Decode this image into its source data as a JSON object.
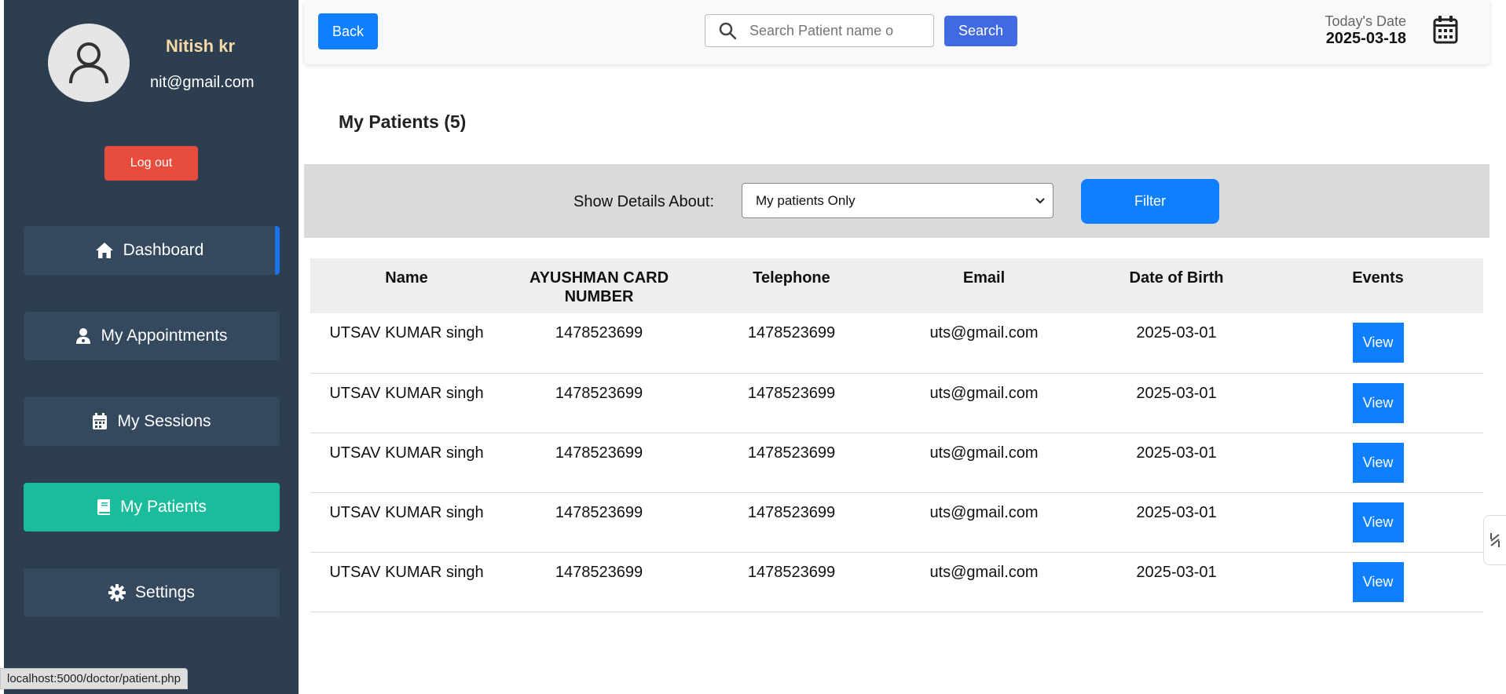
{
  "user": {
    "name": "Nitish kr",
    "email": "nit@gmail.com",
    "logout_label": "Log out"
  },
  "nav": [
    {
      "label": "Dashboard",
      "icon": "home-icon"
    },
    {
      "label": "My Appointments",
      "icon": "doctor-icon"
    },
    {
      "label": "My Sessions",
      "icon": "calendar-icon"
    },
    {
      "label": "My Patients",
      "icon": "book-icon"
    },
    {
      "label": "Settings",
      "icon": "gear-icon"
    }
  ],
  "topbar": {
    "back_label": "Back",
    "search_placeholder": "Search Patient name o",
    "search_label": "Search",
    "date_label": "Today's Date",
    "date_value": "2025-03-18"
  },
  "page_title": "My Patients (5)",
  "filter": {
    "label": "Show Details About:",
    "selected": "My patients Only",
    "button_label": "Filter"
  },
  "table": {
    "headers": [
      "Name",
      "AYUSHMAN CARD NUMBER",
      "Telephone",
      "Email",
      "Date of Birth",
      "Events"
    ],
    "rows": [
      {
        "name": "UTSAV KUMAR singh",
        "card": "1478523699",
        "phone": "1478523699",
        "email": "uts@gmail.com",
        "dob": "2025-03-01",
        "action": "View"
      },
      {
        "name": "UTSAV KUMAR singh",
        "card": "1478523699",
        "phone": "1478523699",
        "email": "uts@gmail.com",
        "dob": "2025-03-01",
        "action": "View"
      },
      {
        "name": "UTSAV KUMAR singh",
        "card": "1478523699",
        "phone": "1478523699",
        "email": "uts@gmail.com",
        "dob": "2025-03-01",
        "action": "View"
      },
      {
        "name": "UTSAV KUMAR singh",
        "card": "1478523699",
        "phone": "1478523699",
        "email": "uts@gmail.com",
        "dob": "2025-03-01",
        "action": "View"
      },
      {
        "name": "UTSAV KUMAR singh",
        "card": "1478523699",
        "phone": "1478523699",
        "email": "uts@gmail.com",
        "dob": "2025-03-01",
        "action": "View"
      }
    ]
  },
  "status_url": "localhost:5000/doctor/patient.php",
  "colors": {
    "sidebar": "#2c3e50",
    "nav_item": "#34495e",
    "active": "#1abc9c",
    "primary": "#0d7fff",
    "danger": "#e74c3c",
    "search": "#4169e1"
  }
}
